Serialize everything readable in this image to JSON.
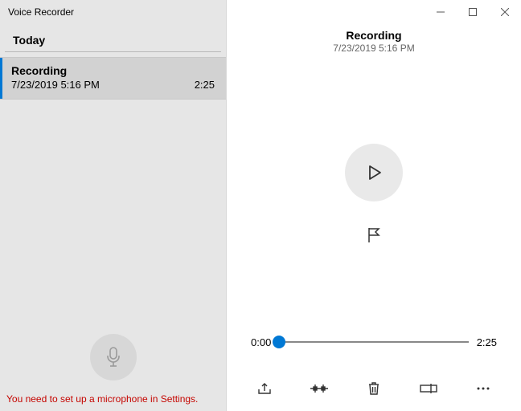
{
  "app_title": "Voice Recorder",
  "sidebar": {
    "section_label": "Today",
    "items": [
      {
        "title": "Recording",
        "timestamp": "7/23/2019 5:16 PM",
        "duration": "2:25"
      }
    ],
    "warning": "You need to set up a microphone in Settings."
  },
  "main": {
    "title": "Recording",
    "timestamp": "7/23/2019 5:16 PM",
    "current_time": "0:00",
    "total_time": "2:25"
  }
}
